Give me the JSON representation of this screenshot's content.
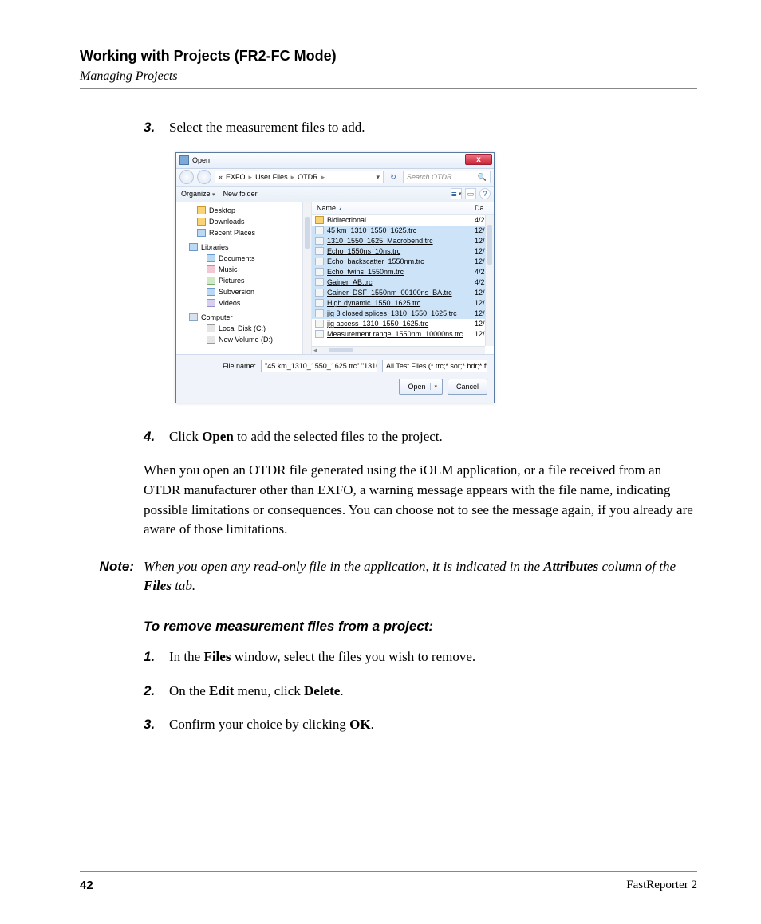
{
  "header": {
    "title": "Working with Projects (FR2-FC Mode)",
    "subtitle": "Managing Projects"
  },
  "step3": {
    "num": "3.",
    "text": "Select the measurement files to add."
  },
  "dialog": {
    "window_title": "Open",
    "close_x": "x",
    "breadcrumbs": {
      "lead": "«",
      "p1": "EXFO",
      "p2": "User Files",
      "p3": "OTDR",
      "sep": "▸",
      "drop": "▾"
    },
    "search_placeholder": "Search OTDR",
    "toolbar": {
      "organize": "Organize",
      "newfolder": "New folder",
      "tri": "▾",
      "view": "≣",
      "pane": "▭",
      "help": "?"
    },
    "sidebar": {
      "desktop": "Desktop",
      "downloads": "Downloads",
      "recent": "Recent Places",
      "libraries": "Libraries",
      "documents": "Documents",
      "music": "Music",
      "pictures": "Pictures",
      "subversion": "Subversion",
      "videos": "Videos",
      "computer": "Computer",
      "localdisk": "Local Disk (C:)",
      "newvol": "New Volume (D:)"
    },
    "filelist": {
      "hdr_name": "Name",
      "hdr_da": "Da",
      "rows": [
        {
          "name": "Bidirectional",
          "da": "4/2",
          "folder": true,
          "sel": false
        },
        {
          "name": "45 km_1310_1550_1625.trc",
          "da": "12/",
          "sel": true
        },
        {
          "name": "1310_1550_1625_Macrobend.trc",
          "da": "12/",
          "sel": true
        },
        {
          "name": "Echo_1550ns_10ns.trc",
          "da": "12/",
          "sel": true
        },
        {
          "name": "Echo_backscatter_1550nm.trc",
          "da": "12/",
          "sel": true
        },
        {
          "name": "Echo_twins_1550nm.trc",
          "da": "4/2",
          "sel": true
        },
        {
          "name": "Gainer_AB.trc",
          "da": "4/2",
          "sel": true
        },
        {
          "name": "Gainer_DSF_1550nm_00100ns_BA.trc",
          "da": "12/",
          "sel": true
        },
        {
          "name": "High dynamic_1550_1625.trc",
          "da": "12/",
          "sel": true
        },
        {
          "name": "jig 3 closed splices_1310_1550_1625.trc",
          "da": "12/",
          "sel": true
        },
        {
          "name": "jig access_1310_1550_1625.trc",
          "da": "12/",
          "sel": false
        },
        {
          "name": "Measurement range_1550nm_10000ns.trc",
          "da": "12/",
          "sel": false
        }
      ]
    },
    "filename_label": "File name:",
    "filename_value": "\"45 km_1310_1550_1625.trc\" \"1310",
    "filetype_value": "All Test Files (*.trc;*.sor;*.bdr;*.f",
    "open_btn": "Open",
    "cancel_btn": "Cancel",
    "dd": "▾"
  },
  "step4": {
    "num": "4.",
    "pre": "Click ",
    "bold": "Open",
    "post": " to add the selected files to the project."
  },
  "para_otdr": "When you open an OTDR file generated using the iOLM application, or a file received from an OTDR manufacturer other than EXFO, a warning message appears with the file name, indicating possible limitations or consequences. You can choose not to see the message again, if you already are aware of those limitations.",
  "note": {
    "label": "Note:",
    "t1": "When you open any read-only file in the application, it is indicated in the ",
    "b1": "Attributes",
    "t2": " column of the ",
    "b2": "Files",
    "t3": " tab."
  },
  "subheading": "To remove measurement files from a project:",
  "r1": {
    "num": "1.",
    "t1": "In the ",
    "b1": "Files",
    "t2": " window, select the files you wish to remove."
  },
  "r2": {
    "num": "2.",
    "t1": "On the ",
    "b1": "Edit",
    "t2": " menu, click ",
    "b2": "Delete",
    "t3": "."
  },
  "r3": {
    "num": "3.",
    "t1": "Confirm your choice by clicking ",
    "b1": "OK",
    "t2": "."
  },
  "footer": {
    "page": "42",
    "product": "FastReporter 2"
  }
}
